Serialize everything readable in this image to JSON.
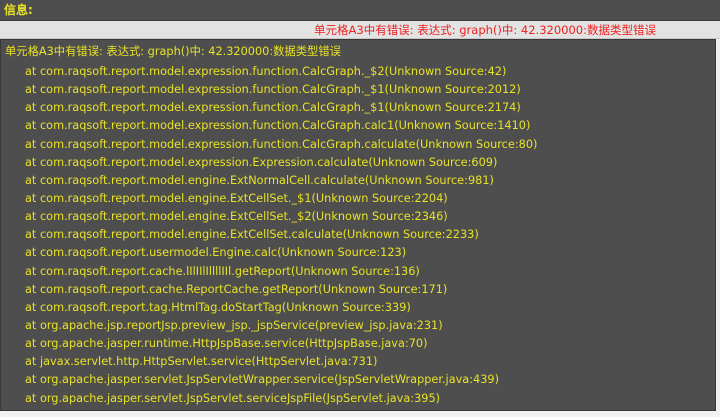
{
  "header": {
    "title": "信息:"
  },
  "summary": {
    "error_text": "单元格A3中有错误: 表达式: graph()中: 42.320000:数据类型错误"
  },
  "detail": {
    "message": "单元格A3中有错误: 表达式: graph()中: 42.320000:数据类型错误",
    "stack_trace": [
      "at com.raqsoft.report.model.expression.function.CalcGraph._$2(Unknown Source:42)",
      "at com.raqsoft.report.model.expression.function.CalcGraph._$1(Unknown Source:2012)",
      "at com.raqsoft.report.model.expression.function.CalcGraph._$1(Unknown Source:2174)",
      "at com.raqsoft.report.model.expression.function.CalcGraph.calc1(Unknown Source:1410)",
      "at com.raqsoft.report.model.expression.function.CalcGraph.calculate(Unknown Source:80)",
      "at com.raqsoft.report.model.expression.Expression.calculate(Unknown Source:609)",
      "at com.raqsoft.report.model.engine.ExtNormalCell.calculate(Unknown Source:981)",
      "at com.raqsoft.report.model.engine.ExtCellSet._$1(Unknown Source:2204)",
      "at com.raqsoft.report.model.engine.ExtCellSet._$2(Unknown Source:2346)",
      "at com.raqsoft.report.model.engine.ExtCellSet.calculate(Unknown Source:2233)",
      "at com.raqsoft.report.usermodel.Engine.calc(Unknown Source:123)",
      "at com.raqsoft.report.cache.lIlIIlIllllIIl.getReport(Unknown Source:136)",
      "at com.raqsoft.report.cache.ReportCache.getReport(Unknown Source:171)",
      "at com.raqsoft.report.tag.HtmlTag.doStartTag(Unknown Source:339)",
      "at org.apache.jsp.reportJsp.preview_jsp._jspService(preview_jsp.java:231)",
      "at org.apache.jasper.runtime.HttpJspBase.service(HttpJspBase.java:70)",
      "at javax.servlet.http.HttpServlet.service(HttpServlet.java:731)",
      "at org.apache.jasper.servlet.JspServletWrapper.service(JspServletWrapper.java:439)",
      "at org.apache.jasper.servlet.JspServlet.serviceJspFile(JspServlet.java:395)"
    ]
  },
  "colors": {
    "panel_background": "#4e4e4e",
    "text_yellow": "#e8e226",
    "summary_background": "#e3e3e3",
    "error_red": "#ee2020"
  }
}
